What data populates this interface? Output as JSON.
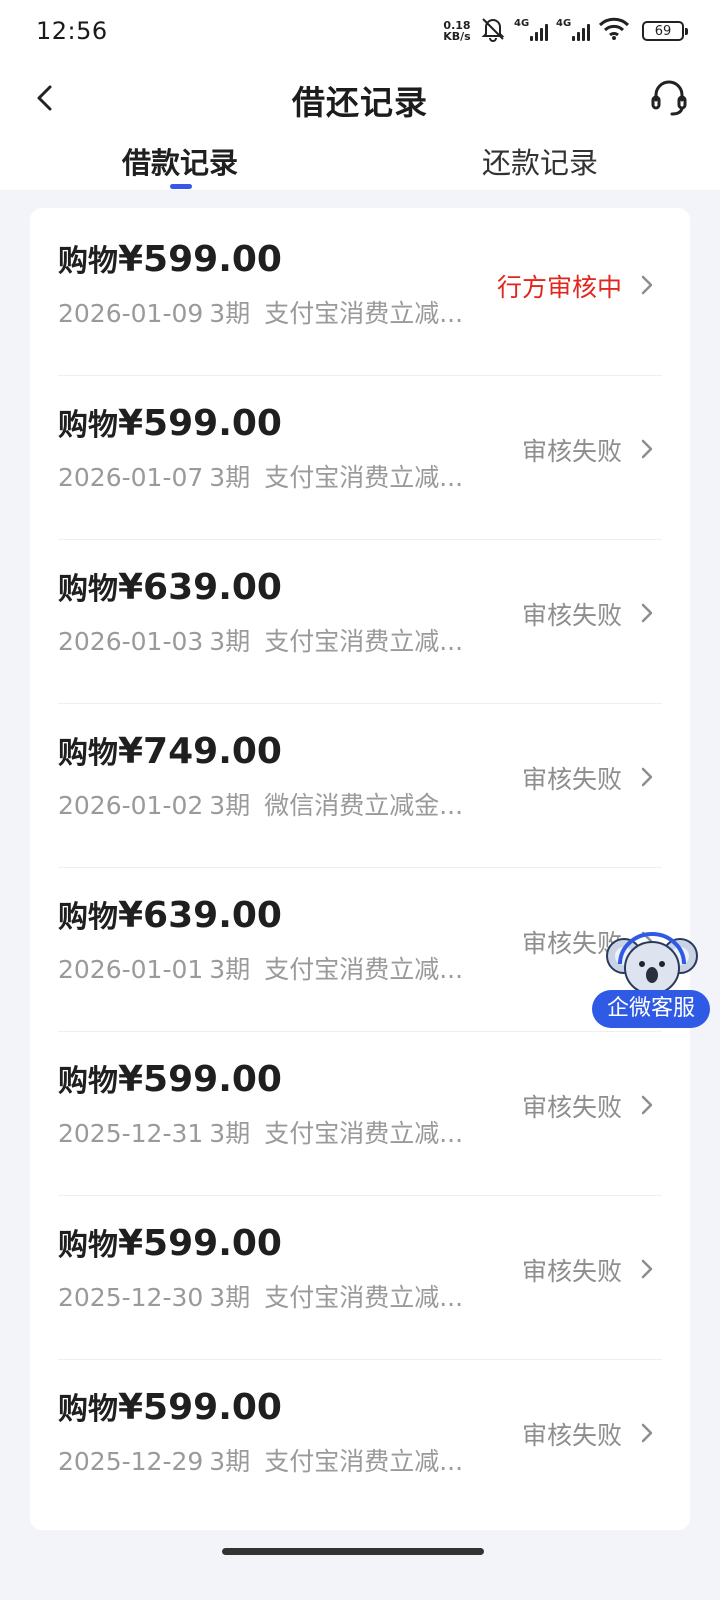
{
  "status_bar": {
    "time": "12:56",
    "net_speed_value": "0.18",
    "net_speed_unit": "KB/s",
    "signal1_label": "4G",
    "signal2_label": "4G",
    "battery": "69"
  },
  "header": {
    "title": "借还记录",
    "back_icon": "chevron-left-icon",
    "support_icon": "headset-icon"
  },
  "tabs": [
    {
      "label": "借款记录",
      "active": true
    },
    {
      "label": "还款记录",
      "active": false
    }
  ],
  "records": [
    {
      "name": "购物",
      "amount": "¥599.00",
      "date": "2026-01-09",
      "term": "3期",
      "desc": "支付宝消费立减...",
      "status": "行方审核中",
      "status_type": "pending"
    },
    {
      "name": "购物",
      "amount": "¥599.00",
      "date": "2026-01-07",
      "term": "3期",
      "desc": "支付宝消费立减...",
      "status": "审核失败",
      "status_type": "failed"
    },
    {
      "name": "购物",
      "amount": "¥639.00",
      "date": "2026-01-03",
      "term": "3期",
      "desc": "支付宝消费立减...",
      "status": "审核失败",
      "status_type": "failed"
    },
    {
      "name": "购物",
      "amount": "¥749.00",
      "date": "2026-01-02",
      "term": "3期",
      "desc": "微信消费立减金...",
      "status": "审核失败",
      "status_type": "failed"
    },
    {
      "name": "购物",
      "amount": "¥639.00",
      "date": "2026-01-01",
      "term": "3期",
      "desc": "支付宝消费立减...",
      "status": "审核失败",
      "status_type": "failed"
    },
    {
      "name": "购物",
      "amount": "¥599.00",
      "date": "2025-12-31",
      "term": "3期",
      "desc": "支付宝消费立减...",
      "status": "审核失败",
      "status_type": "failed"
    },
    {
      "name": "购物",
      "amount": "¥599.00",
      "date": "2025-12-30",
      "term": "3期",
      "desc": "支付宝消费立减...",
      "status": "审核失败",
      "status_type": "failed"
    },
    {
      "name": "购物",
      "amount": "¥599.00",
      "date": "2025-12-29",
      "term": "3期",
      "desc": "支付宝消费立减...",
      "status": "审核失败",
      "status_type": "failed"
    }
  ],
  "floating_service": {
    "label": "企微客服",
    "icon": "koala-mascot-icon"
  },
  "colors": {
    "accent": "#3a57e8",
    "pending": "#e1261d",
    "muted": "#9a9a9a",
    "background": "#f2f4fa"
  }
}
